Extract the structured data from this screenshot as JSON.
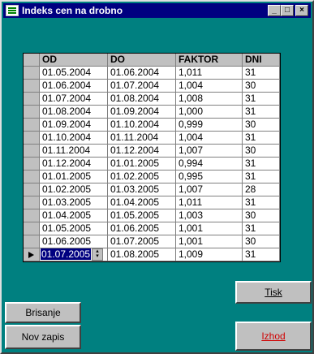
{
  "window": {
    "title": "Indeks cen na drobno"
  },
  "grid": {
    "headers": [
      "OD",
      "DO",
      "FAKTOR",
      "DNI"
    ],
    "rows": [
      [
        "01.05.2004",
        "01.06.2004",
        "1,011",
        "31"
      ],
      [
        "01.06.2004",
        "01.07.2004",
        "1,004",
        "30"
      ],
      [
        "01.07.2004",
        "01.08.2004",
        "1,008",
        "31"
      ],
      [
        "01.08.2004",
        "01.09.2004",
        "1,000",
        "31"
      ],
      [
        "01.09.2004",
        "01.10.2004",
        "0,999",
        "30"
      ],
      [
        "01.10.2004",
        "01.11.2004",
        "1,004",
        "31"
      ],
      [
        "01.11.2004",
        "01.12.2004",
        "1,007",
        "30"
      ],
      [
        "01.12.2004",
        "01.01.2005",
        "0,994",
        "31"
      ],
      [
        "01.01.2005",
        "01.02.2005",
        "0,995",
        "31"
      ],
      [
        "01.02.2005",
        "01.03.2005",
        "1,007",
        "28"
      ],
      [
        "01.03.2005",
        "01.04.2005",
        "1,011",
        "31"
      ],
      [
        "01.04.2005",
        "01.05.2005",
        "1,003",
        "30"
      ],
      [
        "01.05.2005",
        "01.06.2005",
        "1,001",
        "31"
      ],
      [
        "01.06.2005",
        "01.07.2005",
        "1,001",
        "30"
      ],
      [
        "01.07.2005",
        "01.08.2005",
        "1,009",
        "31"
      ]
    ]
  },
  "buttons": {
    "tisk": "Tisk",
    "izhod": "Izhod",
    "brisanje": "Brisanje",
    "nov_zapis": "Nov zapis"
  },
  "colors": {
    "desktop": "#008080",
    "titlebar": "#000080",
    "izhod_text": "#d00000"
  },
  "icons": [
    "app-icon",
    "minimize-icon",
    "maximize-icon",
    "close-icon",
    "row-pointer-icon",
    "spinner-icon"
  ]
}
